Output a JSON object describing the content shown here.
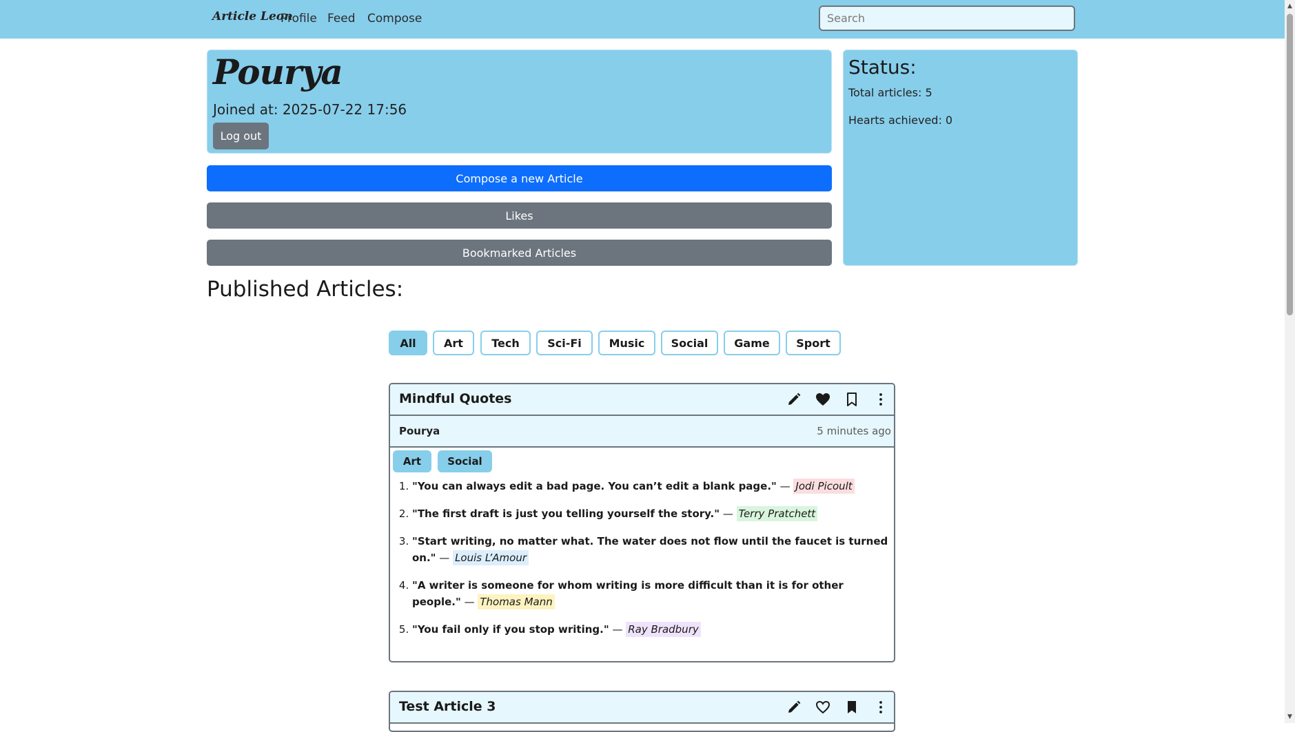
{
  "navbar": {
    "brand": "Article Leon",
    "links": [
      "Profile",
      "Feed",
      "Compose"
    ],
    "search_placeholder": "Search",
    "bg_color": "#87ceeb"
  },
  "profile": {
    "name": "Pourya",
    "joined": "Joined at: 2025-07-22 17:56",
    "logout_label": "Log out"
  },
  "actions": {
    "compose_label": "Compose a new Article",
    "likes_label": "Likes",
    "bookmarks_label": "Bookmarked Articles"
  },
  "status": {
    "title": "Status:",
    "total_articles": "Total articles: 5",
    "hearts": "Hearts achieved: 0"
  },
  "published_heading": "Published Articles:",
  "categories": [
    "All",
    "Art",
    "Tech",
    "Sci-Fi",
    "Music",
    "Social",
    "Game",
    "Sport"
  ],
  "active_category": "All",
  "articles": [
    {
      "title": "Mindful Quotes",
      "author": "Pourya",
      "time": "5 minutes ago",
      "liked": true,
      "bookmarked": false,
      "tags": [
        "Art",
        "Social"
      ],
      "quotes": [
        {
          "text": "\"You can always edit a bad page. You can’t edit a blank page.\"",
          "author": "Jodi Picoult",
          "color": "#fbdde0"
        },
        {
          "text": "\"The first draft is just you telling yourself the story.\"",
          "author": "Terry Pratchett",
          "color": "#d9f5dd"
        },
        {
          "text": "\"Start writing, no matter what. The water does not flow until the faucet is turned on.\"",
          "author": "Louis L’Amour",
          "color": "#dceefc"
        },
        {
          "text": "\"A writer is someone for whom writing is more difficult than it is for other people.\"",
          "author": "Thomas Mann",
          "color": "#fdf3c0"
        },
        {
          "text": "\"You fail only if you stop writing.\"",
          "author": "Ray Bradbury",
          "color": "#efe3fb"
        }
      ]
    },
    {
      "title": "Test Article 3",
      "liked": false,
      "bookmarked": true
    }
  ],
  "dash": "—"
}
